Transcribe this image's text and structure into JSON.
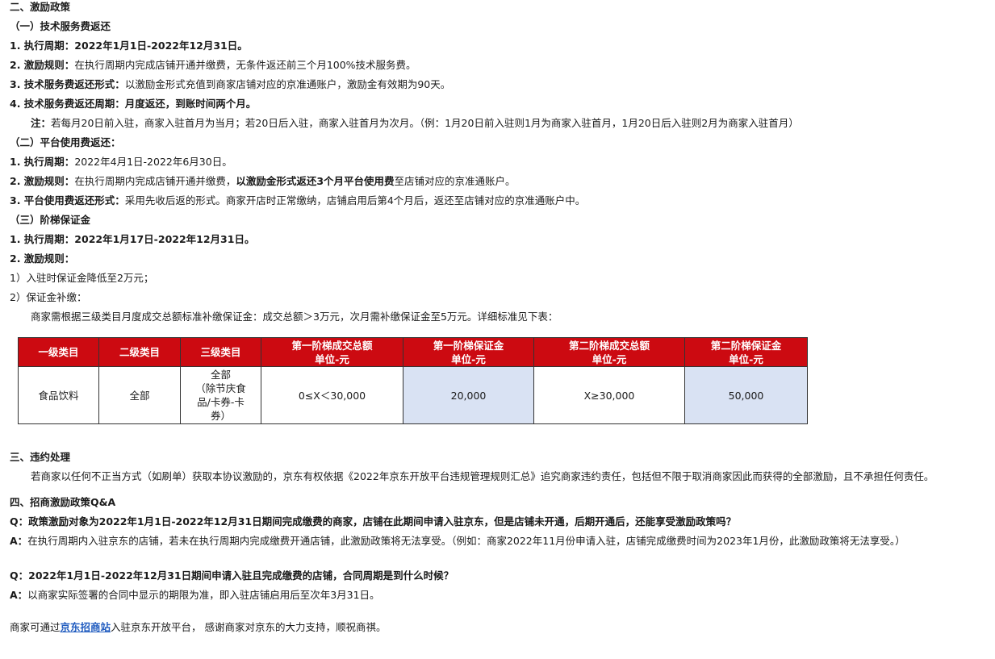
{
  "sec2": {
    "title": "二、激励政策",
    "sub1": {
      "title": "（一）技术服务费返还",
      "item1": "1. 执行周期：2022年1月1日-2022年12月31日。",
      "item2_label": "2. 激励规则：",
      "item2_text": "在执行周期内完成店铺开通并缴费，无条件返还前三个月100%技术服务费。",
      "item3_label": "3. 技术服务费返还形式：",
      "item3_text": "以激励金形式充值到商家店铺对应的京准通账户，激励金有效期为90天。",
      "item4": "4. 技术服务费返还周期：月度返还，到账时间两个月。",
      "note_label": "注：",
      "note_text": "若每月20日前入驻，商家入驻首月为当月；若20日后入驻，商家入驻首月为次月。（例：1月20日前入驻则1月为商家入驻首月，1月20日后入驻则2月为商家入驻首月）"
    },
    "sub2": {
      "title": "（二）平台使用费返还：",
      "item1_label": "1. 执行周期：",
      "item1_text": "2022年4月1日-2022年6月30日。",
      "item2_label": "2. 激励规则：",
      "item2_text_a": "在执行周期内完成店铺开通并缴费，",
      "item2_text_b": "以激励金形式返还3个月平台使用费",
      "item2_text_c": "至店铺对应的京准通账户。",
      "item3_label": "3. 平台使用费返还形式：",
      "item3_text": "采用先收后返的形式。商家开店时正常缴纳，店铺启用后第4个月后，返还至店铺对应的京准通账户中。"
    },
    "sub3": {
      "title": "（三）阶梯保证金",
      "item1": "1. 执行周期：2022年1月17日-2022年12月31日。",
      "item2": "2. 激励规则：",
      "rule1": "1）入驻时保证金降低至2万元；",
      "rule2": "2）保证金补缴：",
      "rule2_desc": "商家需根据三级类目月度成交总额标准补缴保证金：成交总额＞3万元，次月需补缴保证金至5万元。详细标准见下表："
    }
  },
  "table": {
    "headers": [
      {
        "l1": "一级类目",
        "l2": ""
      },
      {
        "l1": "二级类目",
        "l2": ""
      },
      {
        "l1": "三级类目",
        "l2": ""
      },
      {
        "l1": "第一阶梯成交总额",
        "l2": "单位-元"
      },
      {
        "l1": "第一阶梯保证金",
        "l2": "单位-元"
      },
      {
        "l1": "第二阶梯成交总额",
        "l2": "单位-元"
      },
      {
        "l1": "第二阶梯保证金",
        "l2": "单位-元"
      }
    ],
    "row": {
      "c1": "食品饮料",
      "c2": "全部",
      "c3_l1": "全部",
      "c3_l2": "（除节庆食",
      "c3_l3": "品/卡券-卡",
      "c3_l4": "券）",
      "c4": "0≤X＜30,000",
      "c5": "20,000",
      "c6": "X≥30,000",
      "c7": "50,000"
    },
    "colors": {
      "header_bg": "#cc0a11",
      "highlight_bg": "#d9e2f3"
    }
  },
  "sec3": {
    "title": "三、违约处理",
    "text": "若商家以任何不正当方式（如刷单）获取本协议激励的，京东有权依据《2022年京东开放平台违规管理规则汇总》追究商家违约责任，包括但不限于取消商家因此而获得的全部激励，且不承担任何责任。"
  },
  "sec4": {
    "title": "四、招商激励政策Q&A",
    "q1_label": "Q：",
    "q1_text": "政策激励对象为2022年1月1日-2022年12月31日期间完成缴费的商家，店铺在此期间申请入驻京东，但是店铺未开通，后期开通后，还能享受激励政策吗？",
    "a1_label": "A：",
    "a1_text": "在执行周期内入驻京东的店铺，若未在执行周期内完成缴费开通店铺，此激励政策将无法享受。（例如：商家2022年11月份申请入驻，店铺完成缴费时间为2023年1月份，此激励政策将无法享受。）",
    "q2_label": "Q：",
    "q2_text": "2022年1月1日-2022年12月31日期间申请入驻且完成缴费的店铺，合同周期是到什么时候？",
    "a2_label": "A：",
    "a2_text": "以商家实际签署的合同中显示的期限为准，即入驻店铺启用后至次年3月31日。"
  },
  "footer": {
    "pre": "商家可通过",
    "link": "京东招商站",
    "post": "入驻京东开放平台， 感谢商家对京东的大力支持，顺祝商祺。"
  }
}
